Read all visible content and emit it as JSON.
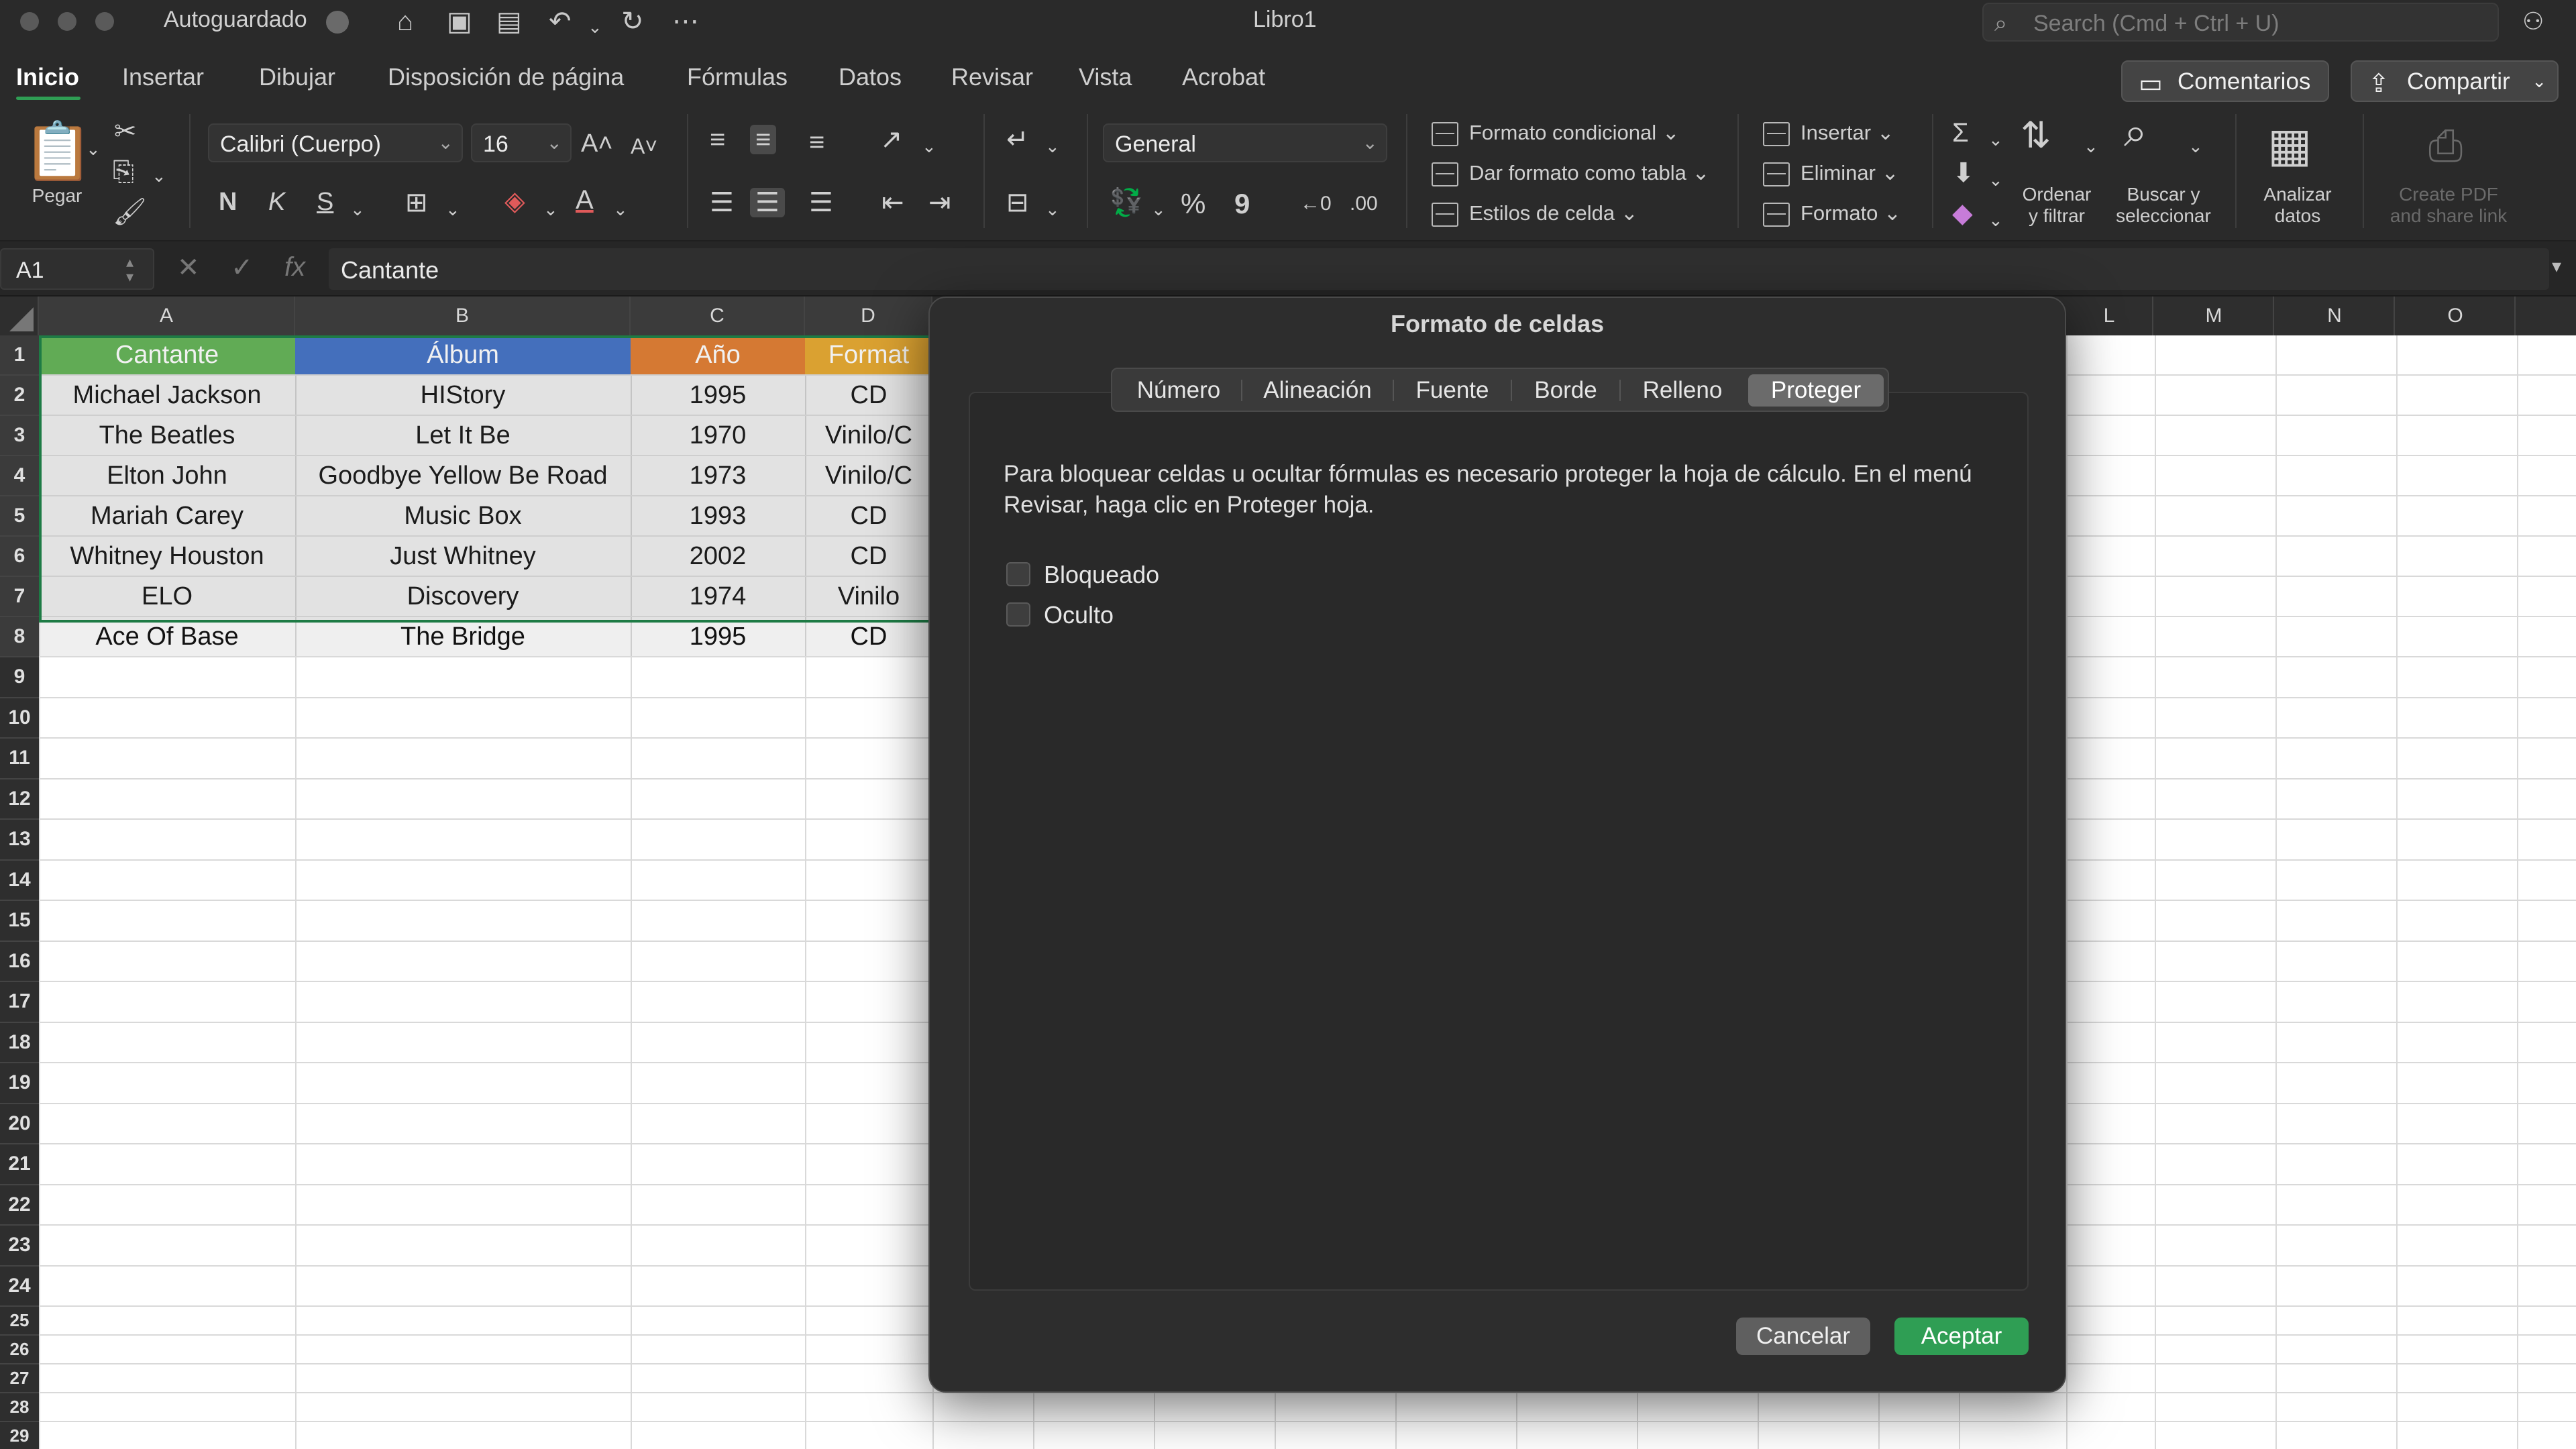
{
  "app": {
    "autosave_label": "Autoguardado",
    "window_title": "Libro1",
    "search_placeholder": "Search (Cmd + Ctrl + U)"
  },
  "tabs": [
    {
      "label": "Inicio"
    },
    {
      "label": "Insertar"
    },
    {
      "label": "Dibujar"
    },
    {
      "label": "Disposición de página"
    },
    {
      "label": "Fórmulas"
    },
    {
      "label": "Datos"
    },
    {
      "label": "Revisar"
    },
    {
      "label": "Vista"
    },
    {
      "label": "Acrobat"
    }
  ],
  "header_buttons": {
    "comments": "Comentarios",
    "share": "Compartir"
  },
  "ribbon": {
    "paste": "Pegar",
    "font_name": "Calibri (Cuerpo)",
    "font_size": "16",
    "bold": "N",
    "italic": "K",
    "underline": "S",
    "number_format": "General",
    "percent": "%",
    "comma": "9",
    "conditional_format": "Formato condicional",
    "format_as_table": "Dar formato como tabla",
    "cell_styles": "Estilos de celda",
    "insert": "Insertar",
    "delete": "Eliminar",
    "format": "Formato",
    "sort_filter_l1": "Ordenar",
    "sort_filter_l2": "y filtrar",
    "find_select_l1": "Buscar y",
    "find_select_l2": "seleccionar",
    "analyze_l1": "Analizar",
    "analyze_l2": "datos",
    "create_pdf_l1": "Create PDF",
    "create_pdf_l2": "and share link"
  },
  "formula_bar": {
    "cell_ref": "A1",
    "fx": "fx",
    "content": "Cantante"
  },
  "columns": [
    "A",
    "B",
    "C",
    "D",
    "L",
    "M",
    "N",
    "O"
  ],
  "rows": [
    "1",
    "2",
    "3",
    "4",
    "5",
    "6",
    "7",
    "8",
    "9",
    "10",
    "11",
    "12",
    "13",
    "14",
    "15",
    "16",
    "17",
    "18",
    "19",
    "20",
    "21",
    "22",
    "23",
    "24",
    "25",
    "26",
    "27",
    "28",
    "29"
  ],
  "table": {
    "headers": [
      "Cantante",
      "Álbum",
      "Año",
      "Format"
    ],
    "header_colors": [
      "#5fb152",
      "#3f6fc4",
      "#e07a2c",
      "#e6a62a"
    ],
    "data": [
      [
        "Michael Jackson",
        "HIStory",
        "1995",
        "CD"
      ],
      [
        "The Beatles",
        "Let It Be",
        "1970",
        "Vinilo/C"
      ],
      [
        "Elton John",
        "Goodbye Yellow Be Road",
        "1973",
        "Vinilo/C"
      ],
      [
        "Mariah Carey",
        "Music Box",
        "1993",
        "CD"
      ],
      [
        "Whitney Houston",
        "Just Whitney",
        "2002",
        "CD"
      ],
      [
        "ELO",
        "Discovery",
        "1974",
        "Vinilo"
      ],
      [
        "Ace Of Base",
        "The Bridge",
        "1995",
        "CD"
      ]
    ]
  },
  "dialog": {
    "title": "Formato de celdas",
    "tabs": [
      "Número",
      "Alineación",
      "Fuente",
      "Borde",
      "Relleno",
      "Proteger"
    ],
    "active_tab": "Proteger",
    "message": "Para bloquear celdas u ocultar fórmulas es necesario proteger la hoja de cálculo. En el menú Revisar, haga clic en Proteger hoja.",
    "locked_label": "Bloqueado",
    "hidden_label": "Oculto",
    "cancel": "Cancelar",
    "ok": "Aceptar"
  },
  "colors": {
    "accent_green": "#2f9e54",
    "selection_border": "#1e7b45"
  }
}
